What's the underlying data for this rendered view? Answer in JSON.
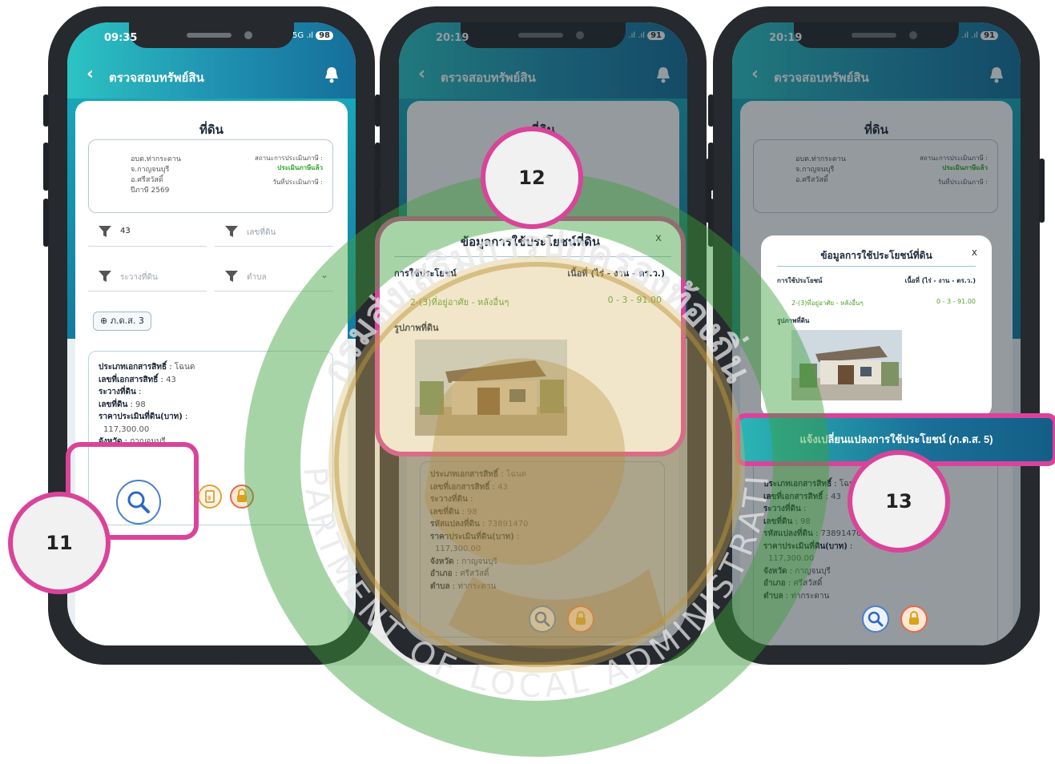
{
  "screens": [
    {
      "status_time": "09:35",
      "status_signal": "5G .ıl",
      "battery": "98",
      "header_title": "ตรวจสอบทรัพย์สิน",
      "card_title": "ที่ดิน",
      "info_left": [
        "อบต.ท่ากระดาน",
        "จ.กาญจนบุรี",
        "อ.ศรีสวัสดิ์",
        "ปีภาษี 2569"
      ],
      "info_status_label": "สถานะการประเมินภาษี :",
      "info_status_value": "ประเมินภาษีแล้ว",
      "info_date_label": "วันที่ประเมินภาษี :",
      "filters": {
        "doc_no_value": "43",
        "land_no_placeholder": "เลขที่ดิน",
        "rawang_placeholder": "ระวางที่ดิน",
        "tambon_placeholder": "ตำบล"
      },
      "chip_label": "ภ.ด.ส. 3",
      "result": {
        "doc_type_label": "ประเภทเอกสารสิทธิ์",
        "doc_type_value": "โฉนด",
        "doc_no_label": "เลขที่เอกสารสิทธิ์",
        "doc_no_value": "43",
        "rawang_label": "ระวางที่ดิน",
        "land_no_label": "เลขที่ดิน",
        "land_no_value": "98",
        "price_label": "ราคาประเมินที่ดิน(บาท)",
        "price_value": "117,300.00",
        "province_label": "จังหวัด",
        "province_value": "กาญจนบุรี"
      }
    },
    {
      "status_time": "20:19",
      "status_signal": ".ıl .ıl",
      "battery": "91",
      "header_title": "ตรวจสอบทรัพย์สิน",
      "card_title": "ที่ดิน",
      "modal": {
        "title": "ข้อมูลการใช้ประโยชน์ที่ดิน",
        "close": "x",
        "col_use": "การใช้ประโยชน์",
        "col_area": "เนื้อที่ (ไร่ - งาน - ตร.ว.)",
        "use_value": "2-(3)ที่อยู่อาศัย - หลังอื่นๆ",
        "area_value": "0 - 3 - 91.00",
        "photo_label": "รูปภาพที่ดิน"
      },
      "result": {
        "doc_type_label": "ประเภทเอกสารสิทธิ์",
        "doc_type_value": "โฉนด",
        "doc_no_label": "เลขที่เอกสารสิทธิ์",
        "doc_no_value": "43",
        "rawang_label": "ระวางที่ดิน",
        "land_no_label": "เลขที่ดิน",
        "land_no_value": "98",
        "parcel_label": "รหัสแปลงที่ดิน",
        "parcel_value": "73891470",
        "price_label": "ราคาประเมินที่ดิน(บาท)",
        "price_value": "117,300.00",
        "province_label": "จังหวัด",
        "province_value": "กาญจนบุรี",
        "amphoe_label": "อำเภอ",
        "amphoe_value": "ศรีสวัสดิ์",
        "tambon_label": "ตำบล",
        "tambon_value": "ท่ากระดาน"
      }
    },
    {
      "status_time": "20:19",
      "status_signal": ".ıl .ıl",
      "battery": "91",
      "header_title": "ตรวจสอบทรัพย์สิน",
      "card_title": "ที่ดิน",
      "cta_label": "แจ้งเปลี่ยนแปลงการใช้ประโยชน์ (ภ.ด.ส. 5)"
    }
  ],
  "callouts": [
    "11",
    "12",
    "13"
  ],
  "watermark": {
    "top_text": "กรมส่งเสริมการปกครองท้องถิ่น",
    "bottom_text": "DEPARTMENT OF LOCAL ADMINISTRATION"
  },
  "colors": {
    "accent": "#1f8fb0",
    "highlight": "#d9449a",
    "status_green": "#27a327"
  }
}
